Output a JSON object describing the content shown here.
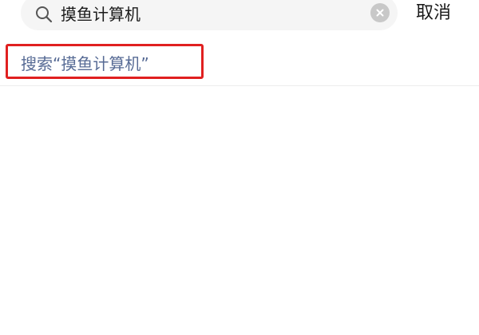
{
  "search": {
    "query": "摸鱼计算机",
    "cancel_label": "取消",
    "search_icon": "search-icon",
    "clear_icon": "clear-icon"
  },
  "suggestion": {
    "prefix": "搜索",
    "open_quote": "“",
    "keyword": "摸鱼计算机",
    "close_quote": "”"
  },
  "colors": {
    "link_text": "#576b95",
    "highlight_border": "#e02020",
    "search_bg": "#f5f5f5",
    "clear_icon_bg": "#c8c8c8"
  }
}
